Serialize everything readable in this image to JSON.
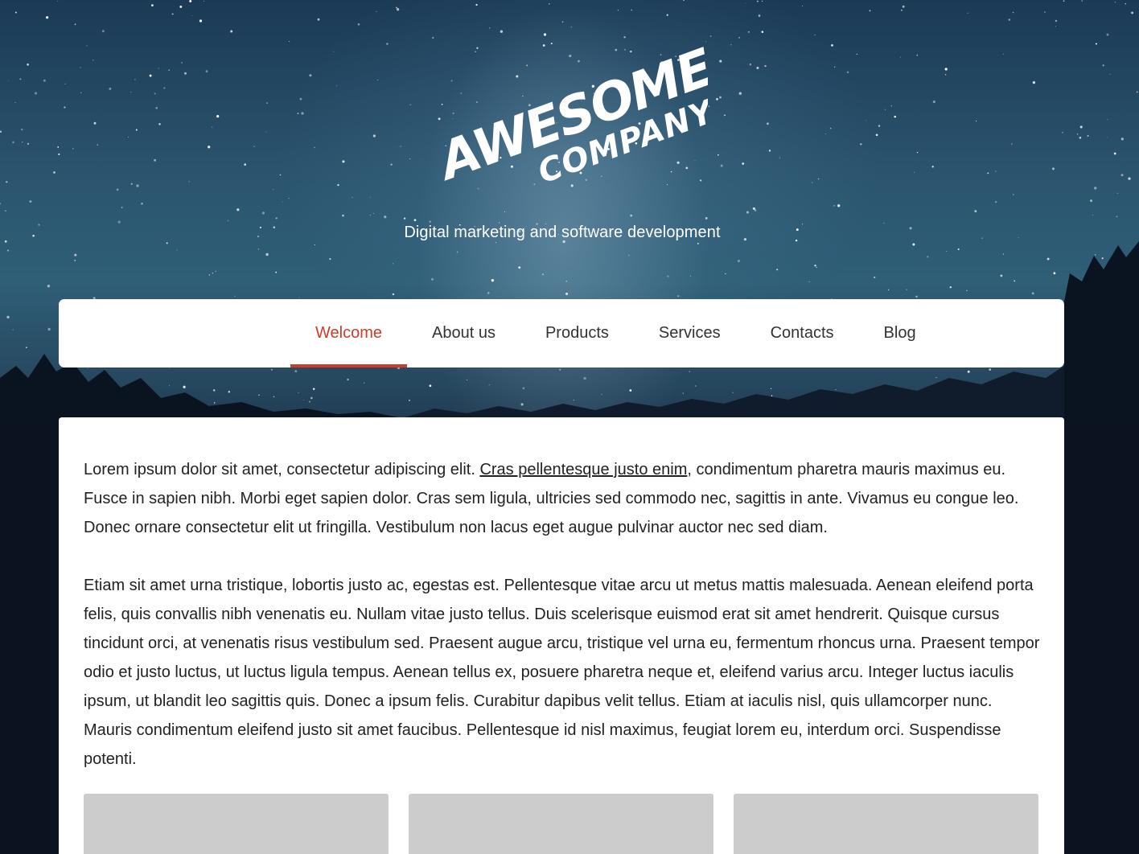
{
  "header": {
    "logo_line1": "AWESOME",
    "logo_line2": "COMPANY",
    "tagline": "Digital marketing and software development"
  },
  "nav": {
    "items": [
      {
        "label": "Welcome",
        "active": true
      },
      {
        "label": "About us",
        "active": false
      },
      {
        "label": "Products",
        "active": false
      },
      {
        "label": "Services",
        "active": false
      },
      {
        "label": "Contacts",
        "active": false
      },
      {
        "label": "Blog",
        "active": false
      }
    ]
  },
  "content": {
    "paragraph1": {
      "before_link": "Lorem ipsum dolor sit amet, consectetur adipiscing elit. ",
      "link": "Cras pellentesque justo enim",
      "after_link": ", condimentum pharetra mauris maximus eu. Fusce in sapien nibh. Morbi eget sapien dolor. Cras sem ligula, ultricies sed commodo nec, sagittis in ante. Vivamus eu congue leo. Donec ornare consectetur elit ut fringilla. Vestibulum non lacus eget augue pulvinar auctor nec sed diam."
    },
    "paragraph2": "Etiam sit amet urna tristique, lobortis justo ac, egestas est. Pellentesque vitae arcu ut metus mattis malesuada. Aenean eleifend porta felis, quis convallis nibh venenatis eu. Nullam vitae justo tellus. Duis scelerisque euismod erat sit amet hendrerit. Quisque cursus tincidunt orci, at venenatis risus vestibulum sed. Praesent augue arcu, tristique vel urna eu, fermentum rhoncus urna. Praesent tempor odio et justo luctus, ut luctus ligula tempus. Aenean tellus ex, posuere pharetra neque et, eleifend varius arcu. Integer luctus iaculis ipsum, ut blandit leo sagittis quis. Donec a ipsum felis. Curabitur dapibus velit tellus. Etiam at iaculis nisl, quis ullamcorper nunc. Mauris condimentum eleifend justo sit amet faucibus. Pellentesque id nisl maximus, feugiat lorem eu, interdum orci. Suspendisse potenti."
  },
  "colors": {
    "accent": "#cd3c27",
    "text": "#222222",
    "card_placeholder": "#cccccc"
  }
}
